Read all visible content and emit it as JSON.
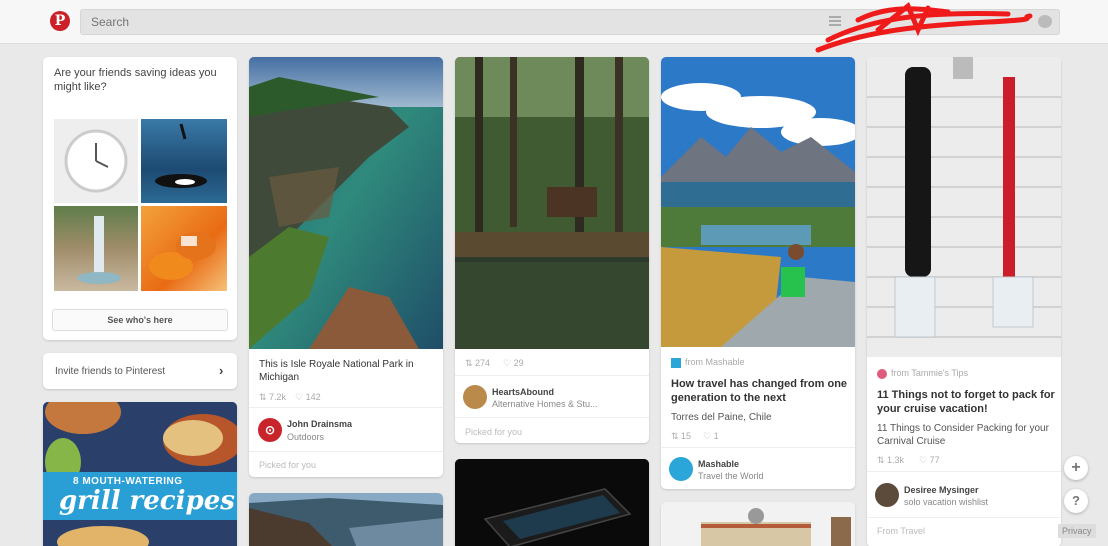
{
  "header": {
    "search_placeholder": "Search"
  },
  "friends_card": {
    "title": "Are your friends saving ideas you might like?",
    "button": "See who's here"
  },
  "invite": {
    "label": "Invite friends to Pinterest"
  },
  "grill": {
    "headline": "8 MOUTH-WATERING",
    "script": "grill recipes"
  },
  "pin_isle": {
    "desc": "This is Isle Royale National Park in Michigan",
    "repins": "7.2k",
    "likes": "142",
    "user": "John Drainsma",
    "board": "Outdoors",
    "footnote": "Picked for you"
  },
  "pin_forest": {
    "repins": "274",
    "likes": "29",
    "user": "HeartsAbound",
    "board": "Alternative Homes & Stu...",
    "footnote": "Picked for you"
  },
  "pin_travel": {
    "source": "from Mashable",
    "title": "How travel has changed from one generation to the next",
    "desc": "Torres del Paine, Chile",
    "repins": "15",
    "likes": "1",
    "user": "Mashable",
    "board": "Travel the World"
  },
  "pin_cruise": {
    "source": "from Tammie's Tips",
    "title": "11 Things not to forget to pack for your cruise vacation!",
    "desc": "11 Things to Consider Packing for your Carnival Cruise",
    "repins": "1.3k",
    "likes": "77",
    "user": "Desiree Mysinger",
    "board": "solo vacation wishlist",
    "footnote": "From Travel"
  },
  "actions": {
    "add": "+",
    "help": "?"
  },
  "footer": {
    "privacy": "Privacy"
  }
}
